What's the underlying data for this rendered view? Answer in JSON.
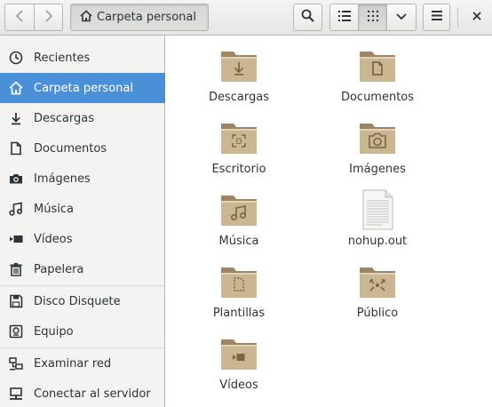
{
  "header": {
    "back_icon": "go-previous-icon",
    "forward_icon": "go-next-icon",
    "path_label": "Carpeta personal",
    "path_icon": "home-icon",
    "search_icon": "search-icon",
    "list_view_icon": "list-view-icon",
    "grid_view_icon": "grid-view-icon",
    "view_options_icon": "chevron-down-icon",
    "menu_icon": "hamburger-menu-icon",
    "close_icon": "close-icon"
  },
  "sidebar": {
    "items": [
      {
        "label": "Recientes",
        "icon": "clock-icon"
      },
      {
        "label": "Carpeta personal",
        "icon": "home-icon",
        "active": true
      },
      {
        "label": "Descargas",
        "icon": "download-icon"
      },
      {
        "label": "Documentos",
        "icon": "document-icon"
      },
      {
        "label": "Imágenes",
        "icon": "camera-icon"
      },
      {
        "label": "Música",
        "icon": "music-icon"
      },
      {
        "label": "Vídeos",
        "icon": "video-icon"
      },
      {
        "label": "Papelera",
        "icon": "trash-icon"
      },
      {
        "label": "Disco Disquete",
        "icon": "floppy-icon"
      },
      {
        "label": "Equipo",
        "icon": "computer-icon"
      },
      {
        "label": "Examinar red",
        "icon": "network-icon"
      },
      {
        "label": "Conectar al servidor",
        "icon": "server-icon"
      }
    ]
  },
  "files": [
    {
      "label": "Descargas",
      "icon": "folder-download-icon"
    },
    {
      "label": "Documentos",
      "icon": "folder-documents-icon"
    },
    {
      "label": "Escritorio",
      "icon": "folder-desktop-icon"
    },
    {
      "label": "Imágenes",
      "icon": "folder-pictures-icon"
    },
    {
      "label": "Música",
      "icon": "folder-music-icon"
    },
    {
      "label": "nohup.out",
      "icon": "text-file-icon"
    },
    {
      "label": "Plantillas",
      "icon": "folder-templates-icon"
    },
    {
      "label": "Público",
      "icon": "folder-public-icon"
    },
    {
      "label": "Vídeos",
      "icon": "folder-videos-icon"
    }
  ],
  "colors": {
    "accent": "#4a90d9",
    "folder": "#c9b38f",
    "folder_dark": "#a08660"
  }
}
